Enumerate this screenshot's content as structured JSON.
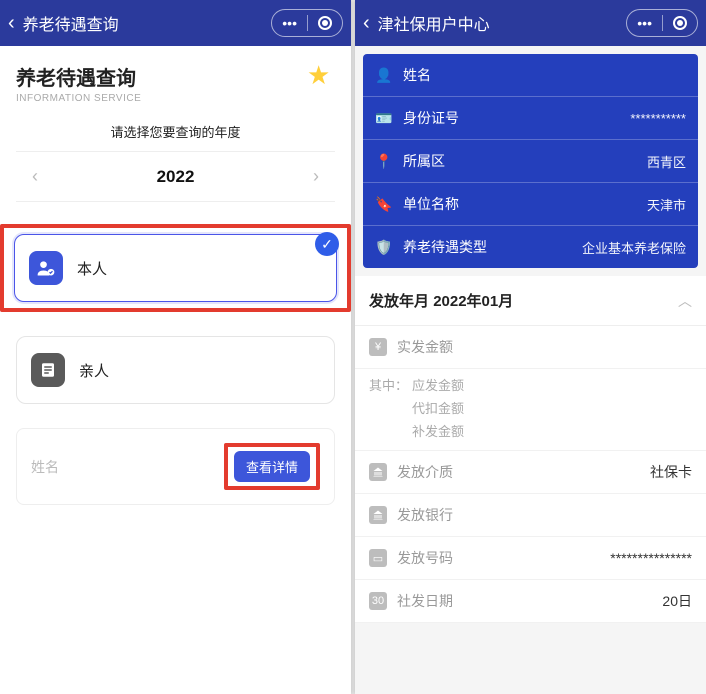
{
  "left": {
    "header_title": "养老待遇查询",
    "page_title": "养老待遇查询",
    "page_subtitle": "INFORMATION SERVICE",
    "year_prompt": "请选择您要查询的年度",
    "year": "2022",
    "option_self": "本人",
    "option_family": "亲人",
    "name_label": "姓名",
    "view_detail": "查看详情"
  },
  "right": {
    "header_title": "津社保用户中心",
    "info": {
      "name_label": "姓名",
      "name_value": "",
      "id_label": "身份证号",
      "id_value": "***********",
      "district_label": "所属区",
      "district_value": "西青区",
      "org_label": "单位名称",
      "org_value": "天津市",
      "type_label": "养老待遇类型",
      "type_value": "企业基本养老保险"
    },
    "issue_period_label": "发放年月",
    "issue_period_value": "2022年01月",
    "details": {
      "actual_label": "实发金额",
      "breakdown_label": "其中：",
      "due_label": "应发金额",
      "deduct_label": "代扣金额",
      "supplement_label": "补发金额",
      "medium_label": "发放介质",
      "medium_value": "社保卡",
      "bank_label": "发放银行",
      "bank_value": "",
      "number_label": "发放号码",
      "number_value": "***************",
      "date_label": "社发日期",
      "date_value": "20日"
    }
  }
}
